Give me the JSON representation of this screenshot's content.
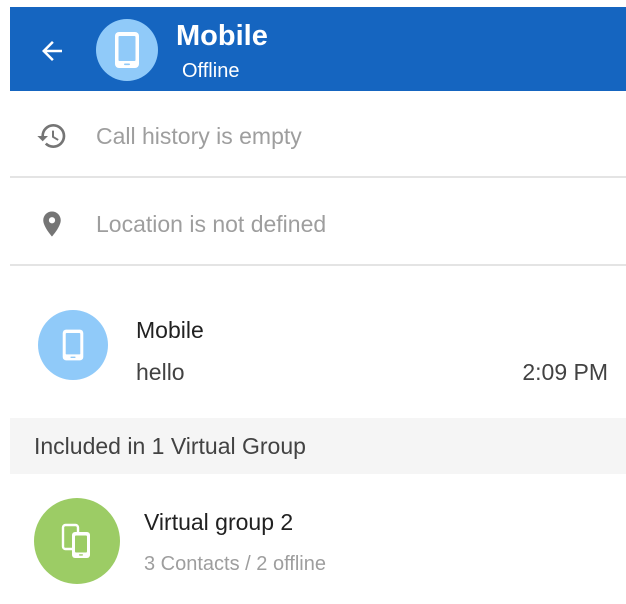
{
  "header": {
    "title": "Mobile",
    "status": "Offline",
    "back_icon": "arrow-back-icon",
    "avatar_icon": "smartphone-icon",
    "color": "#1565c0"
  },
  "info": {
    "call_history": {
      "label": "Call history is empty",
      "icon": "history-icon"
    },
    "location": {
      "label": "Location is not defined",
      "icon": "location-pin-icon"
    }
  },
  "conversation": {
    "name": "Mobile",
    "last_message": "hello",
    "time": "2:09 PM",
    "avatar_icon": "smartphone-icon"
  },
  "groups_section": {
    "header": "Included in 1 Virtual Group",
    "items": [
      {
        "name": "Virtual group 2",
        "subtitle": "3 Contacts / 2 offline",
        "icon": "devices-icon",
        "avatar_color": "#9ccc65"
      }
    ]
  }
}
